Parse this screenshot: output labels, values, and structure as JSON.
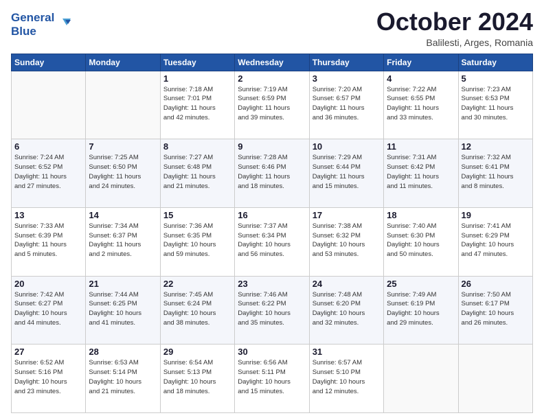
{
  "logo": {
    "line1": "General",
    "line2": "Blue"
  },
  "header": {
    "month": "October 2024",
    "location": "Balilesti, Arges, Romania"
  },
  "weekdays": [
    "Sunday",
    "Monday",
    "Tuesday",
    "Wednesday",
    "Thursday",
    "Friday",
    "Saturday"
  ],
  "weeks": [
    [
      {
        "day": "",
        "info": ""
      },
      {
        "day": "",
        "info": ""
      },
      {
        "day": "1",
        "info": "Sunrise: 7:18 AM\nSunset: 7:01 PM\nDaylight: 11 hours\nand 42 minutes."
      },
      {
        "day": "2",
        "info": "Sunrise: 7:19 AM\nSunset: 6:59 PM\nDaylight: 11 hours\nand 39 minutes."
      },
      {
        "day": "3",
        "info": "Sunrise: 7:20 AM\nSunset: 6:57 PM\nDaylight: 11 hours\nand 36 minutes."
      },
      {
        "day": "4",
        "info": "Sunrise: 7:22 AM\nSunset: 6:55 PM\nDaylight: 11 hours\nand 33 minutes."
      },
      {
        "day": "5",
        "info": "Sunrise: 7:23 AM\nSunset: 6:53 PM\nDaylight: 11 hours\nand 30 minutes."
      }
    ],
    [
      {
        "day": "6",
        "info": "Sunrise: 7:24 AM\nSunset: 6:52 PM\nDaylight: 11 hours\nand 27 minutes."
      },
      {
        "day": "7",
        "info": "Sunrise: 7:25 AM\nSunset: 6:50 PM\nDaylight: 11 hours\nand 24 minutes."
      },
      {
        "day": "8",
        "info": "Sunrise: 7:27 AM\nSunset: 6:48 PM\nDaylight: 11 hours\nand 21 minutes."
      },
      {
        "day": "9",
        "info": "Sunrise: 7:28 AM\nSunset: 6:46 PM\nDaylight: 11 hours\nand 18 minutes."
      },
      {
        "day": "10",
        "info": "Sunrise: 7:29 AM\nSunset: 6:44 PM\nDaylight: 11 hours\nand 15 minutes."
      },
      {
        "day": "11",
        "info": "Sunrise: 7:31 AM\nSunset: 6:42 PM\nDaylight: 11 hours\nand 11 minutes."
      },
      {
        "day": "12",
        "info": "Sunrise: 7:32 AM\nSunset: 6:41 PM\nDaylight: 11 hours\nand 8 minutes."
      }
    ],
    [
      {
        "day": "13",
        "info": "Sunrise: 7:33 AM\nSunset: 6:39 PM\nDaylight: 11 hours\nand 5 minutes."
      },
      {
        "day": "14",
        "info": "Sunrise: 7:34 AM\nSunset: 6:37 PM\nDaylight: 11 hours\nand 2 minutes."
      },
      {
        "day": "15",
        "info": "Sunrise: 7:36 AM\nSunset: 6:35 PM\nDaylight: 10 hours\nand 59 minutes."
      },
      {
        "day": "16",
        "info": "Sunrise: 7:37 AM\nSunset: 6:34 PM\nDaylight: 10 hours\nand 56 minutes."
      },
      {
        "day": "17",
        "info": "Sunrise: 7:38 AM\nSunset: 6:32 PM\nDaylight: 10 hours\nand 53 minutes."
      },
      {
        "day": "18",
        "info": "Sunrise: 7:40 AM\nSunset: 6:30 PM\nDaylight: 10 hours\nand 50 minutes."
      },
      {
        "day": "19",
        "info": "Sunrise: 7:41 AM\nSunset: 6:29 PM\nDaylight: 10 hours\nand 47 minutes."
      }
    ],
    [
      {
        "day": "20",
        "info": "Sunrise: 7:42 AM\nSunset: 6:27 PM\nDaylight: 10 hours\nand 44 minutes."
      },
      {
        "day": "21",
        "info": "Sunrise: 7:44 AM\nSunset: 6:25 PM\nDaylight: 10 hours\nand 41 minutes."
      },
      {
        "day": "22",
        "info": "Sunrise: 7:45 AM\nSunset: 6:24 PM\nDaylight: 10 hours\nand 38 minutes."
      },
      {
        "day": "23",
        "info": "Sunrise: 7:46 AM\nSunset: 6:22 PM\nDaylight: 10 hours\nand 35 minutes."
      },
      {
        "day": "24",
        "info": "Sunrise: 7:48 AM\nSunset: 6:20 PM\nDaylight: 10 hours\nand 32 minutes."
      },
      {
        "day": "25",
        "info": "Sunrise: 7:49 AM\nSunset: 6:19 PM\nDaylight: 10 hours\nand 29 minutes."
      },
      {
        "day": "26",
        "info": "Sunrise: 7:50 AM\nSunset: 6:17 PM\nDaylight: 10 hours\nand 26 minutes."
      }
    ],
    [
      {
        "day": "27",
        "info": "Sunrise: 6:52 AM\nSunset: 5:16 PM\nDaylight: 10 hours\nand 23 minutes."
      },
      {
        "day": "28",
        "info": "Sunrise: 6:53 AM\nSunset: 5:14 PM\nDaylight: 10 hours\nand 21 minutes."
      },
      {
        "day": "29",
        "info": "Sunrise: 6:54 AM\nSunset: 5:13 PM\nDaylight: 10 hours\nand 18 minutes."
      },
      {
        "day": "30",
        "info": "Sunrise: 6:56 AM\nSunset: 5:11 PM\nDaylight: 10 hours\nand 15 minutes."
      },
      {
        "day": "31",
        "info": "Sunrise: 6:57 AM\nSunset: 5:10 PM\nDaylight: 10 hours\nand 12 minutes."
      },
      {
        "day": "",
        "info": ""
      },
      {
        "day": "",
        "info": ""
      }
    ]
  ]
}
